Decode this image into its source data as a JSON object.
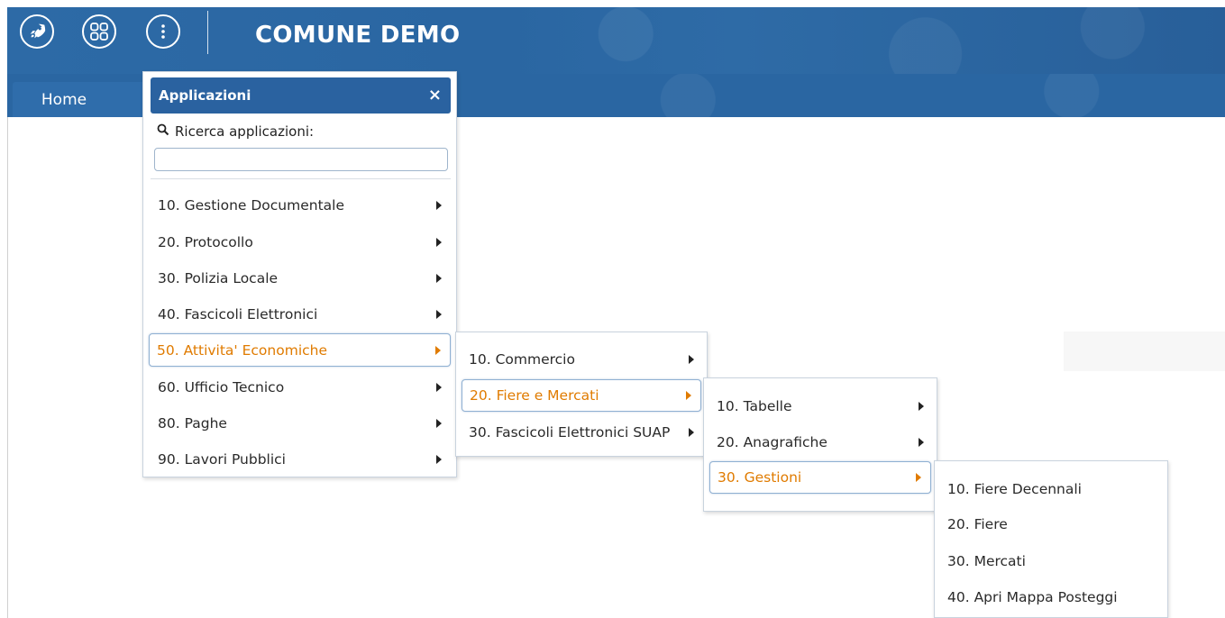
{
  "header": {
    "title": "COMUNE DEMO",
    "icons": [
      "rocket-icon",
      "apps-grid-icon",
      "more-vertical-icon"
    ]
  },
  "tabs": [
    {
      "label": "Home"
    }
  ],
  "app_menu": {
    "title": "Applicazioni",
    "close": "×",
    "search_label": "Ricerca applicazioni:",
    "search_value": "",
    "items": [
      {
        "label": "10. Gestione Documentale"
      },
      {
        "label": "20. Protocollo"
      },
      {
        "label": "30. Polizia Locale"
      },
      {
        "label": "40. Fascicoli Elettronici"
      },
      {
        "label": "50. Attivita' Economiche",
        "active": true
      },
      {
        "label": "60. Ufficio Tecnico"
      },
      {
        "label": "80. Paghe"
      },
      {
        "label": "90. Lavori Pubblici"
      }
    ]
  },
  "submenu1": {
    "items": [
      {
        "label": "10. Commercio"
      },
      {
        "label": "20. Fiere e Mercati",
        "active": true
      },
      {
        "label": "30. Fascicoli Elettronici SUAP"
      }
    ]
  },
  "submenu2": {
    "items": [
      {
        "label": "10. Tabelle"
      },
      {
        "label": "20. Anagrafiche"
      },
      {
        "label": "30. Gestioni",
        "active": true
      }
    ]
  },
  "submenu3": {
    "items": [
      {
        "label": "10. Fiere Decennali"
      },
      {
        "label": "20. Fiere"
      },
      {
        "label": "30. Mercati"
      },
      {
        "label": "40. Apri Mappa Posteggi"
      }
    ]
  },
  "colors": {
    "brand": "#2a66a2",
    "active_text": "#e07b00"
  }
}
